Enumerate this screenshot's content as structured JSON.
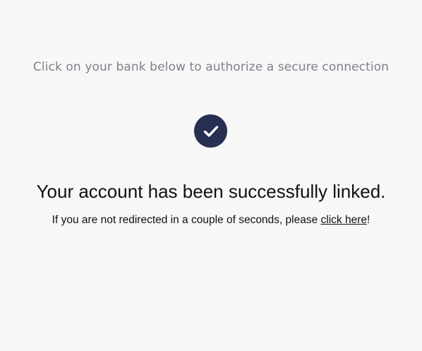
{
  "instruction_text": "Click on your bank below to authorize a secure connection",
  "status": {
    "icon": "check-icon",
    "badge_color": "#273052",
    "headline": "Your account has been successfully linked."
  },
  "redirect": {
    "text_before": "If you are not redirected in a couple of seconds, please ",
    "link_label": "click here",
    "text_after": "!"
  }
}
